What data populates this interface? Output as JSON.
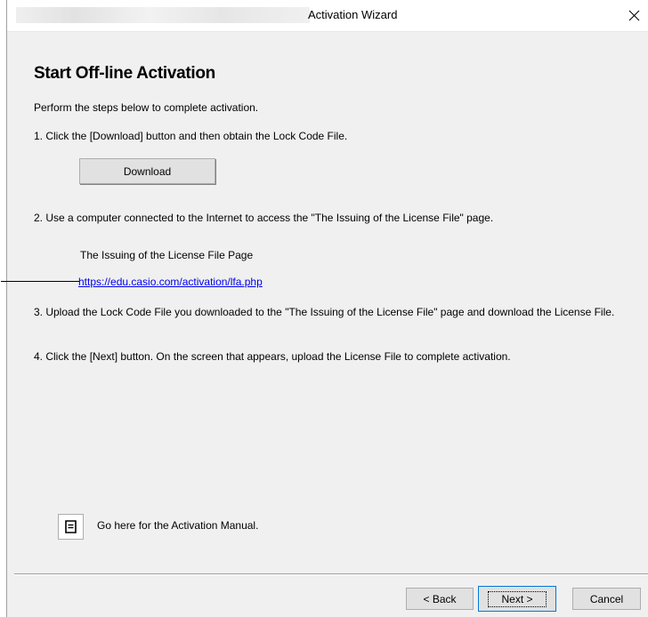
{
  "window": {
    "title": "Activation Wizard",
    "close_icon": "close-icon"
  },
  "main": {
    "heading": "Start Off-line Activation",
    "intro": "Perform the steps below to complete activation.",
    "step1": "1. Click the [Download] button and then obtain the Lock Code File.",
    "download_label": "Download",
    "step2": "2. Use a computer connected to the Internet to access the \"The Issuing of the License File\" page.",
    "license_page_label": "The Issuing of the License File Page",
    "license_link": "https://edu.casio.com/activation/lfa.php",
    "step3": "3. Upload the Lock Code File you downloaded to the \"The Issuing of the License File\" page and download the License File.",
    "step4": "4. Click the [Next] button. On the screen that appears, upload the License File to complete activation.",
    "manual_text": "Go here for the Activation Manual.",
    "manual_icon": "document-icon"
  },
  "footer": {
    "back_label": "< Back",
    "next_label": "Next >",
    "cancel_label": "Cancel"
  }
}
